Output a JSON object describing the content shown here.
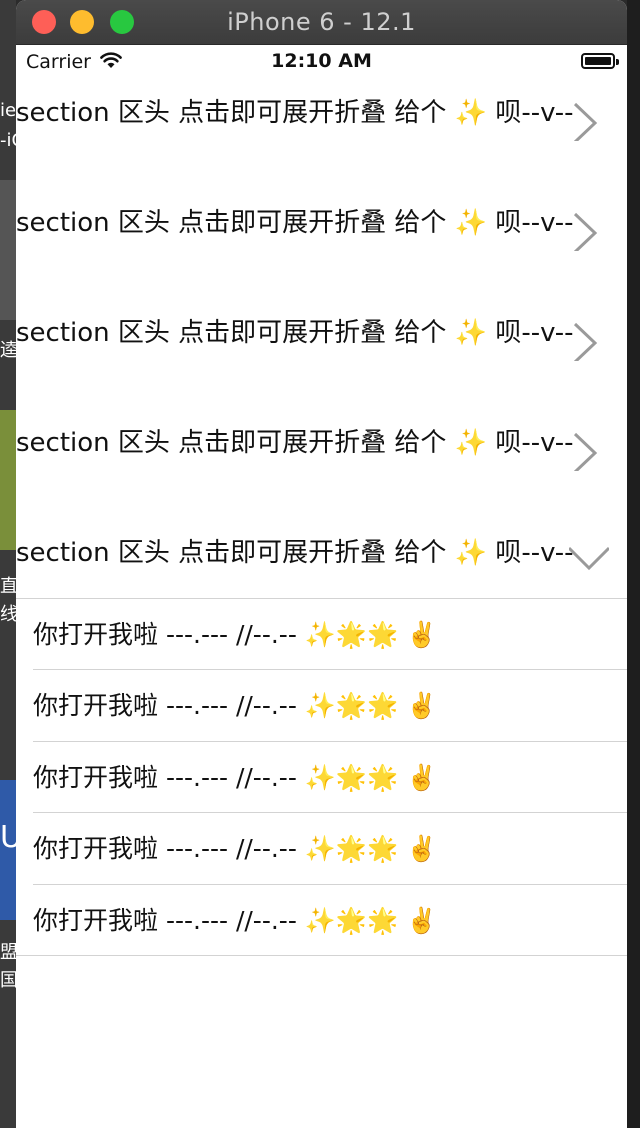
{
  "window": {
    "title": "iPhone 6 - 12.1"
  },
  "status_bar": {
    "carrier": "Carrier",
    "time": "12:10 AM",
    "icons": [
      "wifi-icon",
      "battery-icon"
    ]
  },
  "sections": [
    {
      "header": "section 区头 点击即可展开折叠 给个 ✨ 呗--v--",
      "chevron": "chevron-right-icon",
      "expanded": false
    },
    {
      "header": "section 区头 点击即可展开折叠 给个 ✨ 呗--v--",
      "chevron": "chevron-right-icon",
      "expanded": false
    },
    {
      "header": "section 区头 点击即可展开折叠 给个 ✨ 呗--v--",
      "chevron": "chevron-right-icon",
      "expanded": false
    },
    {
      "header": "section 区头 点击即可展开折叠 给个 ✨ 呗--v--",
      "chevron": "chevron-right-icon",
      "expanded": false
    },
    {
      "header": "section 区头 点击即可展开折叠 给个 ✨ 呗--v--",
      "chevron": "chevron-down-icon",
      "expanded": true
    }
  ],
  "rows": [
    "你打开我啦 ---.--- //--.--  ✨🌟🌟 ✌️",
    "你打开我啦 ---.--- //--.--  ✨🌟🌟 ✌️",
    "你打开我啦 ---.--- //--.--  ✨🌟🌟 ✌️",
    "你打开我啦 ---.--- //--.--  ✨🌟🌟 ✌️",
    "你打开我啦 ---.--- //--.--  ✨🌟🌟 ✌️"
  ],
  "background_fragments": [
    "ie",
    "-iC",
    "逵ゞ",
    "直",
    "线",
    "U",
    "盟",
    "国"
  ],
  "colors": {
    "close": "#fe5f57",
    "minimize": "#febc2e",
    "maximize": "#28c840",
    "separator": "#d3d3d3",
    "chevron": "#9a9a9a"
  }
}
